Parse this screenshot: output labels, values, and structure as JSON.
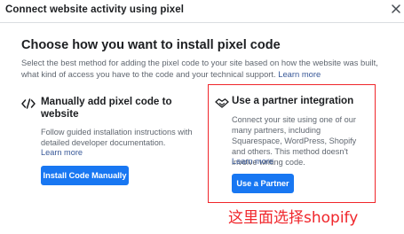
{
  "window": {
    "title": "Connect website activity using pixel"
  },
  "main": {
    "heading": "Choose how you want to install pixel code",
    "description": "Select the best method for adding the pixel code to your site based on how the website was built, what kind of access you have to the code and your technical support.",
    "description_link": "Learn more"
  },
  "manual_card": {
    "title": "Manually add pixel code to website",
    "description": "Follow guided installation instructions with detailed developer documentation.",
    "link": "Learn more",
    "button": "Install Code Manually"
  },
  "partner_card": {
    "title": "Use a partner integration",
    "description": "Connect your site using one of our many partners, including Squarespace, WordPress, Shopify and others. This method doesn't involve writing code.",
    "link": "Learn more",
    "button": "Use a Partner"
  },
  "annotation": {
    "text": "这里面选择shopify",
    "color": "#f0262b"
  },
  "colors": {
    "accent": "#1877f2",
    "link": "#385898",
    "highlight": "#f0262b"
  },
  "icons": [
    "close-icon",
    "code-icon",
    "handshake-icon"
  ]
}
